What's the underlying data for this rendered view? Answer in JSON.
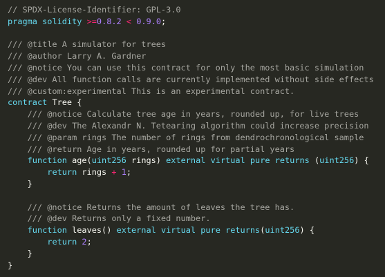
{
  "editor": {
    "lines": [
      [
        {
          "t": "// SPDX-License-Identifier: GPL-3.0",
          "c": "comment"
        }
      ],
      [
        {
          "t": "pragma",
          "c": "keyword"
        },
        {
          "t": " ",
          "c": "space"
        },
        {
          "t": "solidity",
          "c": "keyword"
        },
        {
          "t": " ",
          "c": "space"
        },
        {
          "t": ">=",
          "c": "operator"
        },
        {
          "t": "0.8.2",
          "c": "number"
        },
        {
          "t": " ",
          "c": "space"
        },
        {
          "t": "<",
          "c": "operator"
        },
        {
          "t": " ",
          "c": "space"
        },
        {
          "t": "0.9.0",
          "c": "number"
        },
        {
          "t": ";",
          "c": "punct"
        }
      ],
      [],
      [
        {
          "t": "/// @title A simulator for trees",
          "c": "comment"
        }
      ],
      [
        {
          "t": "/// @author Larry A. Gardner",
          "c": "comment"
        }
      ],
      [
        {
          "t": "/// @notice You can use this contract for only the most basic simulation",
          "c": "comment"
        }
      ],
      [
        {
          "t": "/// @dev All function calls are currently implemented without side effects",
          "c": "comment"
        }
      ],
      [
        {
          "t": "/// @custom:experimental This is an experimental contract.",
          "c": "comment"
        }
      ],
      [
        {
          "t": "contract",
          "c": "keyword"
        },
        {
          "t": " Tree {",
          "c": "ident"
        }
      ],
      [
        {
          "t": "    /// @notice Calculate tree age in years, rounded up, for live trees",
          "c": "comment"
        }
      ],
      [
        {
          "t": "    /// @dev The Alexandr N. Tetearing algorithm could increase precision",
          "c": "comment"
        }
      ],
      [
        {
          "t": "    /// @param rings The number of rings from dendrochronological sample",
          "c": "comment"
        }
      ],
      [
        {
          "t": "    /// @return Age in years, rounded up for partial years",
          "c": "comment"
        }
      ],
      [
        {
          "t": "    ",
          "c": "space"
        },
        {
          "t": "function",
          "c": "keyword"
        },
        {
          "t": " age(",
          "c": "ident"
        },
        {
          "t": "uint256",
          "c": "type"
        },
        {
          "t": " rings) ",
          "c": "ident"
        },
        {
          "t": "external",
          "c": "keyword"
        },
        {
          "t": " ",
          "c": "space"
        },
        {
          "t": "virtual",
          "c": "keyword"
        },
        {
          "t": " ",
          "c": "space"
        },
        {
          "t": "pure",
          "c": "keyword"
        },
        {
          "t": " ",
          "c": "space"
        },
        {
          "t": "returns",
          "c": "keyword"
        },
        {
          "t": " (",
          "c": "punct"
        },
        {
          "t": "uint256",
          "c": "type"
        },
        {
          "t": ") {",
          "c": "punct"
        }
      ],
      [
        {
          "t": "        ",
          "c": "space"
        },
        {
          "t": "return",
          "c": "keyword"
        },
        {
          "t": " rings ",
          "c": "ident"
        },
        {
          "t": "+",
          "c": "operator"
        },
        {
          "t": " ",
          "c": "space"
        },
        {
          "t": "1",
          "c": "number"
        },
        {
          "t": ";",
          "c": "punct"
        }
      ],
      [
        {
          "t": "    }",
          "c": "punct"
        }
      ],
      [],
      [
        {
          "t": "    /// @notice Returns the amount of leaves the tree has.",
          "c": "comment"
        }
      ],
      [
        {
          "t": "    /// @dev Returns only a fixed number.",
          "c": "comment"
        }
      ],
      [
        {
          "t": "    ",
          "c": "space"
        },
        {
          "t": "function",
          "c": "keyword"
        },
        {
          "t": " leaves() ",
          "c": "ident"
        },
        {
          "t": "external",
          "c": "keyword"
        },
        {
          "t": " ",
          "c": "space"
        },
        {
          "t": "virtual",
          "c": "keyword"
        },
        {
          "t": " ",
          "c": "space"
        },
        {
          "t": "pure",
          "c": "keyword"
        },
        {
          "t": " ",
          "c": "space"
        },
        {
          "t": "returns",
          "c": "keyword"
        },
        {
          "t": "(",
          "c": "punct"
        },
        {
          "t": "uint256",
          "c": "type"
        },
        {
          "t": ") {",
          "c": "punct"
        }
      ],
      [
        {
          "t": "        ",
          "c": "space"
        },
        {
          "t": "return",
          "c": "keyword"
        },
        {
          "t": " ",
          "c": "space"
        },
        {
          "t": "2",
          "c": "number"
        },
        {
          "t": ";",
          "c": "punct"
        }
      ],
      [
        {
          "t": "    }",
          "c": "punct"
        }
      ],
      [
        {
          "t": "}",
          "c": "punct"
        }
      ]
    ]
  },
  "colors": {
    "background": "#272822",
    "comment": "#a6a6a0",
    "keyword": "#66d9ef",
    "type": "#66d9ef",
    "operator": "#f92672",
    "number": "#ae81ff",
    "text": "#f8f8f2"
  }
}
